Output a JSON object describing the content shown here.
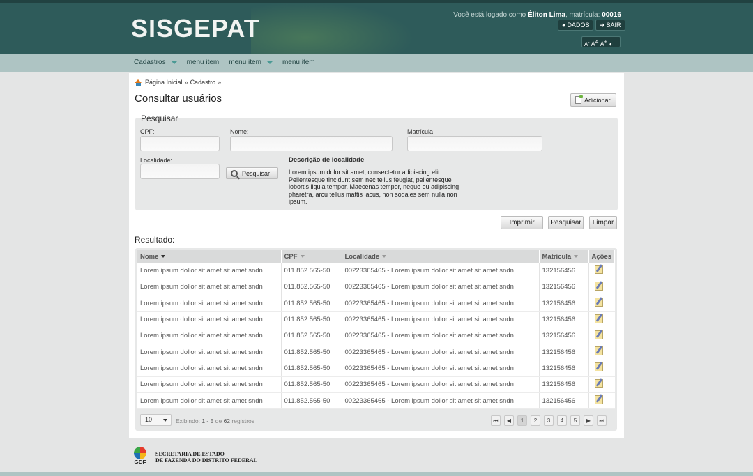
{
  "header": {
    "logo": "SISGEPAT",
    "user_prefix": "Você está logado como",
    "user_name": "Éliton Lima",
    "matricula_label": ", matrícula:",
    "matricula": "00016",
    "dados_label": "DADOS",
    "sair_label": "SAIR",
    "font_small": "A",
    "font_normal": "A",
    "font_large": "A",
    "contrast": "◐"
  },
  "menu": [
    {
      "label": "Cadastros",
      "dropdown": true
    },
    {
      "label": "menu item",
      "dropdown": false
    },
    {
      "label": "menu item",
      "dropdown": true
    },
    {
      "label": "menu item",
      "dropdown": false
    }
  ],
  "breadcrumb": {
    "home": "Página Inicial",
    "sep": "»",
    "current": "Cadastro",
    "trail_end": "»"
  },
  "page_title": "Consultar usuários",
  "add_label": "Adicionar",
  "search": {
    "legend": "Pesquisar",
    "cpf_label": "CPF:",
    "nome_label": "Nome:",
    "matricula_label": "Matrícula",
    "localidade_label": "Localidade:",
    "pesquisar_label": "Pesquisar",
    "desc_title": "Descrição de localidade",
    "desc_text": "Lorem ipsum dolor sit amet, consectetur adipiscing elit. Pellentesque tincidunt sem nec tellus feugiat, pellentesque lobortis ligula tempor. Maecenas tempor, neque eu adipiscing pharetra, arcu tellus mattis lacus, non sodales sem nulla non ipsum."
  },
  "actions": {
    "imprimir": "Imprimir",
    "pesquisar": "Pesquisar",
    "limpar": "Limpar"
  },
  "result_label": "Resultado:",
  "table": {
    "headers": {
      "nome": "Nome",
      "cpf": "CPF",
      "localidade": "Localidade",
      "matricula": "Matrícula",
      "acoes": "Ações"
    },
    "rows": [
      {
        "nome": "Lorem ipsum dollor sit amet sit amet sndn",
        "cpf": "011.852.565-50",
        "localidade": "00223365465 - Lorem ipsum dollor sit amet sit amet sndn",
        "matricula": "132156456"
      },
      {
        "nome": "Lorem ipsum dollor sit amet sit amet sndn",
        "cpf": "011.852.565-50",
        "localidade": "00223365465 - Lorem ipsum dollor sit amet sit amet sndn",
        "matricula": "132156456"
      },
      {
        "nome": "Lorem ipsum dollor sit amet sit amet sndn",
        "cpf": "011.852.565-50",
        "localidade": "00223365465 - Lorem ipsum dollor sit amet sit amet sndn",
        "matricula": "132156456"
      },
      {
        "nome": "Lorem ipsum dollor sit amet sit amet sndn",
        "cpf": "011.852.565-50",
        "localidade": "00223365465 - Lorem ipsum dollor sit amet sit amet sndn",
        "matricula": "132156456"
      },
      {
        "nome": "Lorem ipsum dollor sit amet sit amet sndn",
        "cpf": "011.852.565-50",
        "localidade": "00223365465 - Lorem ipsum dollor sit amet sit amet sndn",
        "matricula": "132156456"
      },
      {
        "nome": "Lorem ipsum dollor sit amet sit amet sndn",
        "cpf": "011.852.565-50",
        "localidade": "00223365465 - Lorem ipsum dollor sit amet sit amet sndn",
        "matricula": "132156456"
      },
      {
        "nome": "Lorem ipsum dollor sit amet sit amet sndn",
        "cpf": "011.852.565-50",
        "localidade": "00223365465 - Lorem ipsum dollor sit amet sit amet sndn",
        "matricula": "132156456"
      },
      {
        "nome": "Lorem ipsum dollor sit amet sit amet sndn",
        "cpf": "011.852.565-50",
        "localidade": "00223365465 - Lorem ipsum dollor sit amet sit amet sndn",
        "matricula": "132156456"
      },
      {
        "nome": "Lorem ipsum dollor sit amet sit amet sndn",
        "cpf": "011.852.565-50",
        "localidade": "00223365465 - Lorem ipsum dollor sit amet sit amet sndn",
        "matricula": "132156456"
      }
    ]
  },
  "pager": {
    "page_size": "10",
    "exibindo": "Exibindo:",
    "range": "1 - 5",
    "de": "de",
    "total": "62",
    "registros": "registros",
    "first": "⏮",
    "prev": "◀",
    "pages": [
      "1",
      "2",
      "3",
      "4",
      "5"
    ],
    "current_page": "1",
    "next": "▶",
    "last": "⏭"
  },
  "footer": {
    "gdf": "GDF",
    "line1": "SECRETARIA DE ESTADO",
    "line2": "DE FAZENDA DO DISTRITO FEDERAL"
  },
  "colors": {
    "header": "#2e5b5a",
    "menubar": "#aec4c3",
    "accent": "#4b9a95"
  }
}
